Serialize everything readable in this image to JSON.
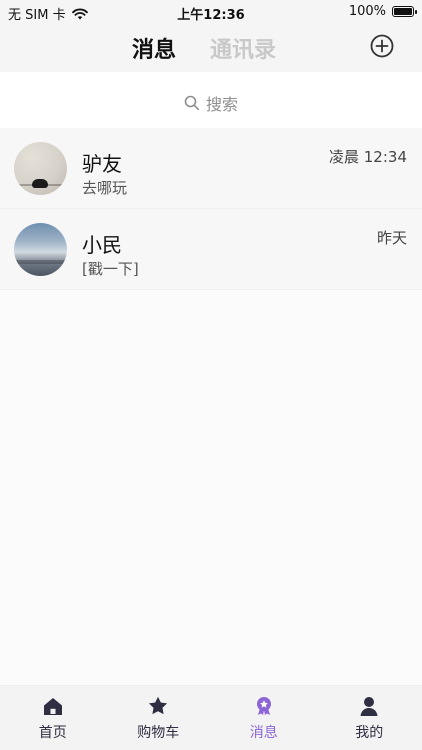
{
  "status_bar": {
    "carrier": "无 SIM 卡",
    "time": "上午12:36",
    "battery": "100%"
  },
  "header": {
    "tabs": [
      {
        "label": "消息"
      },
      {
        "label": "通讯录"
      }
    ]
  },
  "search": {
    "placeholder": "搜索"
  },
  "conversations": [
    {
      "name": "驴友",
      "message": "去哪玩",
      "time": "凌晨 12:34"
    },
    {
      "name": "小民",
      "message": "[戳一下]",
      "time": "昨天"
    }
  ],
  "tabbar": {
    "items": [
      {
        "label": "首页",
        "icon": "home-icon"
      },
      {
        "label": "购物车",
        "icon": "star-icon"
      },
      {
        "label": "消息",
        "icon": "badge-icon"
      },
      {
        "label": "我的",
        "icon": "person-icon"
      }
    ]
  },
  "colors": {
    "accent": "#8c66d6",
    "icon_dark": "#2f2e42"
  }
}
